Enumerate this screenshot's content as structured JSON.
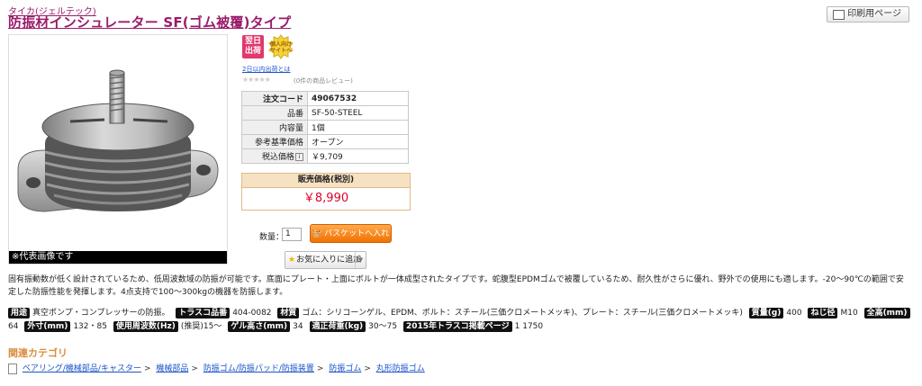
{
  "brand": "タイカ(ジェルテック)",
  "title": "防振材インシュレーター SF(ゴム被覆)タイプ",
  "print_button": "印刷用ページ",
  "photo_caption": "※代表画像です",
  "badges": {
    "next_day": [
      "翌日",
      "出荷"
    ],
    "personal": [
      "個人向け",
      "サイトへ"
    ]
  },
  "ship_link": "2日以内出荷とは",
  "rating": {
    "stars": "★★★★★",
    "review_text": "(0件の商品レビュー)"
  },
  "spec": [
    {
      "label": "注文コード",
      "value": "49067532"
    },
    {
      "label": "品番",
      "value": "SF-50-STEEL"
    },
    {
      "label": "内容量",
      "value": "1個"
    },
    {
      "label": "参考基準価格",
      "value": "オープン"
    },
    {
      "label": "税込価格",
      "value": "￥9,709"
    }
  ],
  "tax_icon": "i",
  "price": {
    "label": "販売価格(税別)",
    "value": "￥8,990"
  },
  "quantity": {
    "label": "数量：",
    "value": "1"
  },
  "cart_button": "バスケットへ入れる",
  "favorite_button": "お気に入りに追加",
  "description": "固有振動数が低く設計されているため、低周波数域の防振が可能です。底面にプレート・上面にボルトが一体成型されたタイプです。蛇腹型EPDMゴムで被覆しているため、耐久性がさらに優れ、野外での使用にも適します。-20～90℃の範囲で安定した防振性能を発揮します。4点支持で100～300kgの機器を防振します。",
  "properties": [
    {
      "tag": "用途",
      "value": "真空ポンプ・コンプレッサーの防振。"
    },
    {
      "tag": "トラスコ品番",
      "value": "404-0082"
    },
    {
      "tag": "材質",
      "value": "ゴム：シリコーンゲル、EPDM、ボルト：スチール(三価クロメートメッキ)、プレート：スチール(三価クロメートメッキ)"
    },
    {
      "tag": "質量(g)",
      "value": "400"
    },
    {
      "tag": "ねじ径",
      "value": "M10"
    },
    {
      "tag": "全高(mm)",
      "value": "64"
    },
    {
      "tag": "外寸(mm)",
      "value": "132・85"
    },
    {
      "tag": "使用周波数(Hz)",
      "value": "(推奨)15～"
    },
    {
      "tag": "ゲル高さ(mm)",
      "value": "34"
    },
    {
      "tag": "適正荷重(kg)",
      "value": "30～75"
    },
    {
      "tag": "2015年トラスコ掲載ページ",
      "value": "1 1750"
    }
  ],
  "related_heading": "関連カテゴリ",
  "breadcrumb": [
    "ベアリング/機械部品/キャスター",
    "機械部品",
    "防振ゴム/防振パッド/防振装置",
    "防振ゴム",
    "丸形防振ゴム"
  ],
  "breadcrumb_sep": ">",
  "colors": {
    "brand": "#9a1c6b",
    "price": "#e0002b",
    "cart": "#f27100",
    "heading": "#d98d3a",
    "link": "#1a53c8"
  }
}
